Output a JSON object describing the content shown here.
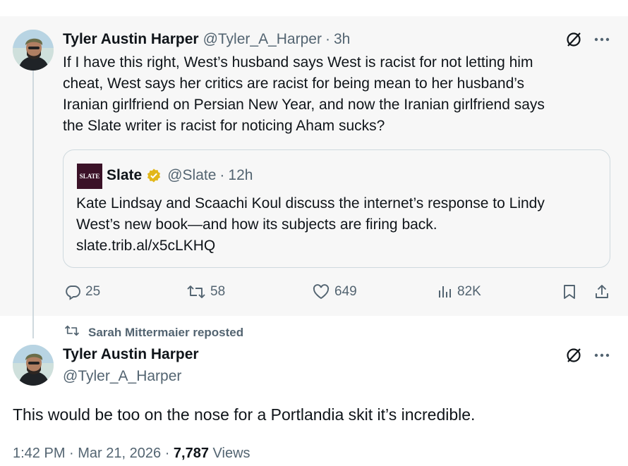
{
  "parent_tweet": {
    "author_name": "Tyler Austin Harper",
    "author_handle": "@Tyler_A_Harper",
    "time": "3h",
    "text_lines": [
      "If I have this right, West’s husband says West is racist for not letting him",
      "cheat, West says her critics are racist for being mean to her husband’s",
      "Iranian girlfriend on Persian New Year, and now the Iranian girlfriend says",
      "the Slate writer is racist for noticing Aham sucks?"
    ],
    "quote": {
      "logo_text": "SLATE",
      "name": "Slate",
      "handle": "@Slate",
      "time": "12h",
      "text_lines": [
        "Kate Lindsay and Scaachi Koul discuss the internet’s response to Lindy",
        "West’s new book—and how its subjects are firing back."
      ],
      "link": "slate.trib.al/x5cLKHQ"
    },
    "actions": {
      "replies": "25",
      "reposts": "58",
      "likes": "649",
      "views": "82K"
    }
  },
  "repost_context": "Sarah Mittermaier reposted",
  "main_tweet": {
    "author_name": "Tyler Austin Harper",
    "author_handle": "@Tyler_A_Harper",
    "text": "This would be too on the nose for a Portlandia skit it’s incredible.",
    "time": "1:42 PM",
    "date": "Mar 21, 2026",
    "views_count": "7,787",
    "views_label": "Views"
  },
  "colors": {
    "muted": "#536471",
    "text": "#0f1419",
    "verified_gold": "#e2b719",
    "slate_brand": "#3b1228",
    "thread_line": "#cfd9de"
  },
  "icons": [
    "no-entry-grok-icon",
    "more-icon",
    "reply-icon",
    "repost-icon",
    "like-icon",
    "views-icon",
    "bookmark-icon",
    "share-icon",
    "verified-badge-icon"
  ]
}
